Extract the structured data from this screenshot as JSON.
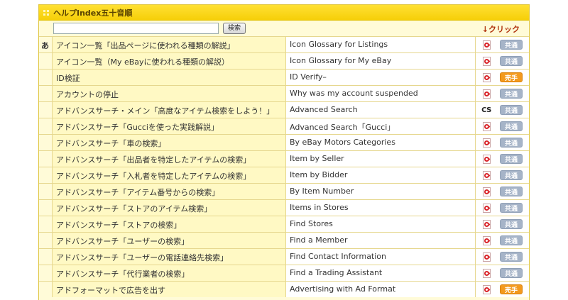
{
  "header": {
    "title": "ヘルプIndex五十音順"
  },
  "search": {
    "value": "",
    "button_label": "検索"
  },
  "hint": "↓クリック",
  "colors": {
    "title_bar": "#f6cf08",
    "common_tag": "#a6b4c8",
    "seller_tag": "#f39a1e",
    "pdf_icon": "#d9242a"
  },
  "rows": [
    {
      "group": "あ",
      "ja": "アイコン一覧「出品ページに使われる種類の解説」",
      "en": "Icon Glossary for Listings",
      "icon": "pdf-icon",
      "tag": "共通",
      "tag_type": "common"
    },
    {
      "group": "",
      "ja": "アイコン一覧（My eBayに使われる種類の解説）",
      "en": "Icon Glossary for My eBay",
      "icon": "pdf-icon",
      "tag": "共通",
      "tag_type": "common"
    },
    {
      "group": "",
      "ja": "ID検証",
      "en": "ID Verify–",
      "icon": "pdf-icon",
      "tag": "売手",
      "tag_type": "seller"
    },
    {
      "group": "",
      "ja": "アカウントの停止",
      "en": "Why was my account suspended",
      "icon": "pdf-icon",
      "tag": "共通",
      "tag_type": "common"
    },
    {
      "group": "",
      "ja": "アドバンスサーチ・メイン「高度なアイテム検索をしよう！」",
      "en": "Advanced Search",
      "icon": "cs",
      "tag": "共通",
      "tag_type": "common"
    },
    {
      "group": "",
      "ja": "アドバンスサーチ「Gucciを使った実践解説」",
      "en": "Advanced Search「Gucci」",
      "icon": "pdf-icon",
      "tag": "共通",
      "tag_type": "common"
    },
    {
      "group": "",
      "ja": "アドバンスサーチ「車の検索」",
      "en": "By eBay Motors Categories",
      "icon": "pdf-icon",
      "tag": "共通",
      "tag_type": "common"
    },
    {
      "group": "",
      "ja": "アドバンスサーチ「出品者を特定したアイテムの検索」",
      "en": "Item by Seller",
      "icon": "pdf-icon",
      "tag": "共通",
      "tag_type": "common"
    },
    {
      "group": "",
      "ja": "アドバンスサーチ「入札者を特定したアイテムの検索」",
      "en": "Item by Bidder",
      "icon": "pdf-icon",
      "tag": "共通",
      "tag_type": "common"
    },
    {
      "group": "",
      "ja": "アドバンスサーチ「アイテム番号からの検索」",
      "en": "By Item Number",
      "icon": "pdf-icon",
      "tag": "共通",
      "tag_type": "common"
    },
    {
      "group": "",
      "ja": "アドバンスサーチ「ストアのアイテム検索」",
      "en": "Items in Stores",
      "icon": "pdf-icon",
      "tag": "共通",
      "tag_type": "common"
    },
    {
      "group": "",
      "ja": "アドバンスサーチ「ストアの検索」",
      "en": "Find Stores",
      "icon": "pdf-icon",
      "tag": "共通",
      "tag_type": "common"
    },
    {
      "group": "",
      "ja": "アドバンスサーチ「ユーザーの検索」",
      "en": "Find a Member",
      "icon": "pdf-icon",
      "tag": "共通",
      "tag_type": "common"
    },
    {
      "group": "",
      "ja": "アドバンスサーチ「ユーザーの電話連絡先検索」",
      "en": "Find Contact Information",
      "icon": "pdf-icon",
      "tag": "共通",
      "tag_type": "common"
    },
    {
      "group": "",
      "ja": "アドバンスサーチ「代行業者の検索」",
      "en": "Find a Trading Assistant",
      "icon": "pdf-icon",
      "tag": "共通",
      "tag_type": "common"
    },
    {
      "group": "",
      "ja": "アドフォーマットで広告を出す",
      "en": "Advertising with Ad Format",
      "icon": "pdf-icon",
      "tag": "売手",
      "tag_type": "seller"
    }
  ]
}
